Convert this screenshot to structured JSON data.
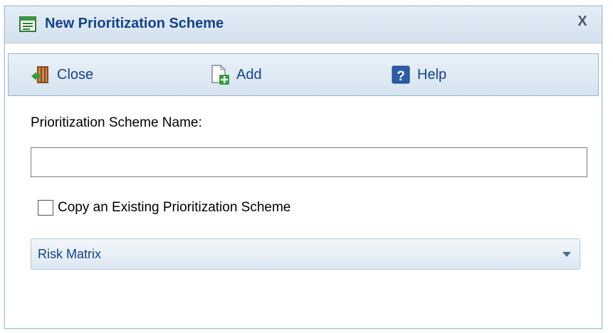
{
  "dialog": {
    "title": "New Prioritization Scheme",
    "close_glyph": "X",
    "title_icon": "form-icon"
  },
  "toolbar": {
    "close_label": "Close",
    "close_icon": "exit-door-icon",
    "add_label": "Add",
    "add_icon": "add-document-icon",
    "help_label": "Help",
    "help_icon": "help-icon"
  },
  "form": {
    "name_label": "Prioritization Scheme Name:",
    "name_value": "",
    "copy_label": "Copy an Existing Prioritization Scheme",
    "copy_checked": false,
    "scheme_selected": "Risk Matrix"
  },
  "colors": {
    "title_text": "#15428b",
    "toolbar_bg": "#dfe9f4",
    "border": "#99b4d1"
  }
}
